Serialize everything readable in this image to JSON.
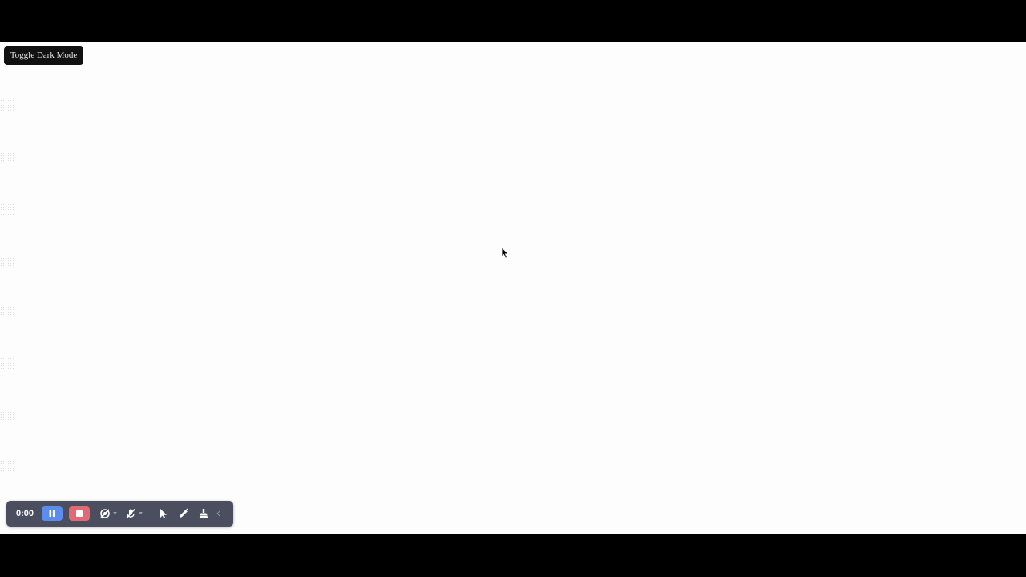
{
  "page": {
    "toggle_button_label": "Toggle Dark Mode"
  },
  "recorder_toolbar": {
    "timer": "0:00",
    "colors": {
      "background": "#4a4e5e",
      "pause": "#5b8def",
      "stop": "#e26a74"
    },
    "icons": [
      "pause-icon",
      "stop-icon",
      "camera-off-icon",
      "microphone-off-icon",
      "pointer-icon",
      "pen-icon",
      "eraser-icon",
      "chevron-left-icon"
    ]
  }
}
